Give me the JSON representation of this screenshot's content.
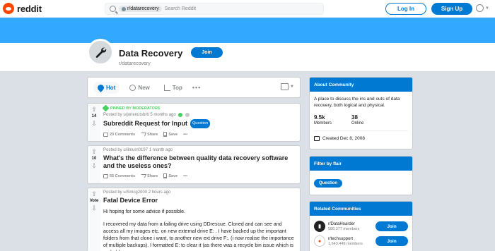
{
  "header": {
    "logo_text": "reddit",
    "search_chip": "r/datarecovery",
    "search_placeholder": "Search Reddit",
    "login_label": "Log In",
    "signup_label": "Sign Up"
  },
  "community": {
    "title": "Data Recovery",
    "name": "r/datarecovery",
    "join_label": "Join",
    "icon": "wrench-icon"
  },
  "sort": {
    "hot": "Hot",
    "new": "New",
    "top": "Top",
    "more": "•••"
  },
  "posts": [
    {
      "pinned_label": "PINNED BY MODERATORS",
      "meta": "Posted by u/jonenutsbrb 5 months ago",
      "votes": "14",
      "title": "Subreddit Request for Input",
      "flair": "Question",
      "comments": "23 Comments",
      "share": "Share",
      "save": "Save",
      "more": "•••"
    },
    {
      "meta": "Posted by u/ilmurri0197 1 month ago",
      "votes": "10",
      "title": "What's the difference between quality data recovery software and the useless ones?",
      "comments": "55 Comments",
      "share": "Share",
      "save": "Save",
      "more": "•••"
    },
    {
      "meta": "Posted by u/Smcg2000 2 hours ago",
      "votes": "Vote",
      "title": "Fatal Device Error",
      "text_1": "Hi hoping for some advice if possible.",
      "text_2": "I recovered my data from a failing drive using DDrescue. Cloned and can see and access all my images etc. on new external drive E: . I have backed up the important folders from that clone i want, to another new ext drive F:. (i now realise the importance of multiple backups). I formatted E: to clear it (as there was a recycle bin issue which is probably"
    }
  ],
  "about": {
    "heading": "About Community",
    "description": "A place to discuss the ins and outs of data recovery, both logical and physical.",
    "members_count": "9.5k",
    "members_label": "Members",
    "online_count": "38",
    "online_label": "Online",
    "created": "Created Dec 8, 2008"
  },
  "flair_filter": {
    "heading": "Filter by flair",
    "button": "Question"
  },
  "related": {
    "heading": "Related Communities",
    "items": [
      {
        "name": "r/DataHoarder",
        "members": "586,377 members",
        "join": "Join"
      },
      {
        "name": "r/techsupport",
        "members": "1,643,449 members",
        "join": "Join"
      }
    ]
  }
}
